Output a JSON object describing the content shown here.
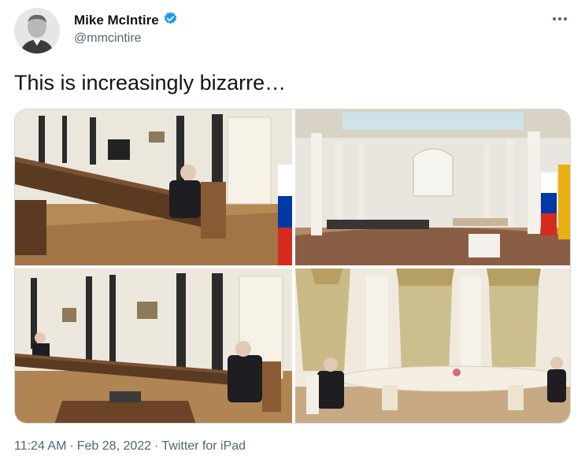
{
  "author": {
    "name": "Mike McIntire",
    "handle": "@mmcintire",
    "verified": true,
    "verified_color": "#1d9bf0"
  },
  "menu_icon": "more-horizontal-icon",
  "tweet": {
    "text": "This is increasingly bizarre…"
  },
  "photos": [
    {
      "description": "Office with long table, person seated at far end"
    },
    {
      "description": "Large white colonnaded hall with flags"
    },
    {
      "description": "Office with long table, person seated near window"
    },
    {
      "description": "Room with curtains and long oval white table"
    }
  ],
  "meta": {
    "time": "11:24 AM",
    "separator": "·",
    "date": "Feb 28, 2022",
    "source": "Twitter for iPad"
  }
}
